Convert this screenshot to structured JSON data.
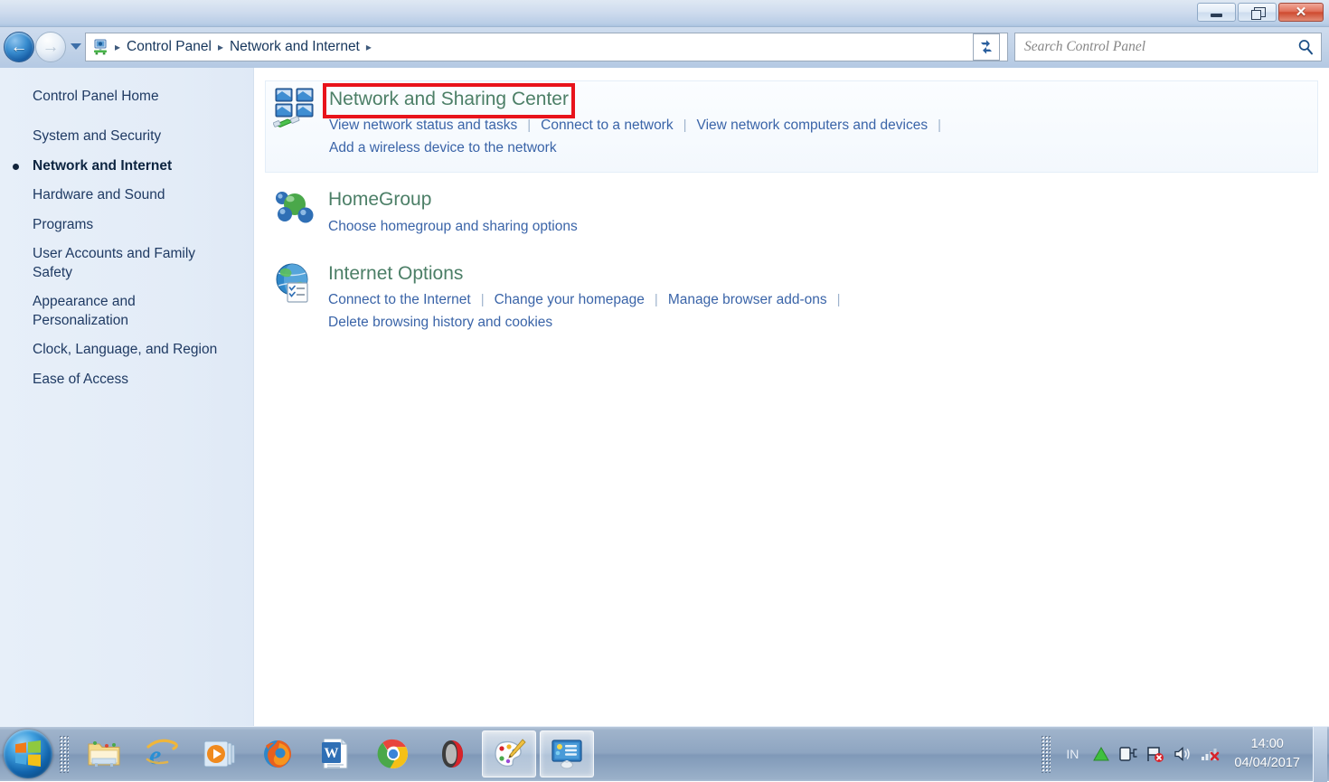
{
  "window": {
    "controls": {
      "minimize_label": "Minimize",
      "maximize_label": "Maximize",
      "close_label": "✕"
    }
  },
  "nav": {
    "back_label": "←",
    "forward_label": "→",
    "recent_pages_label": "Recent pages",
    "breadcrumb_icon": "control-panel-icon",
    "breadcrumbs": [
      {
        "label": "Control Panel"
      },
      {
        "label": "Network and Internet"
      }
    ],
    "separator": "▸",
    "history_dropdown_label": "Previous locations",
    "refresh_label": "Refresh"
  },
  "search": {
    "placeholder": "Search Control Panel",
    "value": "",
    "icon": "search-icon"
  },
  "sidebar": {
    "home": {
      "label": "Control Panel Home"
    },
    "items": [
      {
        "label": "System and Security",
        "active": false
      },
      {
        "label": "Network and Internet",
        "active": true
      },
      {
        "label": "Hardware and Sound",
        "active": false
      },
      {
        "label": "Programs",
        "active": false
      },
      {
        "label": "User Accounts and Family Safety",
        "active": false
      },
      {
        "label": "Appearance and Personalization",
        "active": false
      },
      {
        "label": "Clock, Language, and Region",
        "active": false
      },
      {
        "label": "Ease of Access",
        "active": false
      }
    ]
  },
  "content": {
    "categories": [
      {
        "title": "Network and Sharing Center",
        "icon": "network-sharing-center-icon",
        "highlighted": true,
        "rows": [
          [
            "View network status and tasks",
            "Connect to a network",
            "View network computers and devices"
          ],
          [
            "Add a wireless device to the network"
          ]
        ]
      },
      {
        "title": "HomeGroup",
        "icon": "homegroup-icon",
        "highlighted": false,
        "rows": [
          [
            "Choose homegroup and sharing options"
          ]
        ]
      },
      {
        "title": "Internet Options",
        "icon": "internet-options-icon",
        "highlighted": false,
        "rows": [
          [
            "Connect to the Internet",
            "Change your homepage",
            "Manage browser add-ons"
          ],
          [
            "Delete browsing history and cookies"
          ]
        ]
      }
    ]
  },
  "taskbar": {
    "start_label": "Start",
    "items": [
      {
        "name": "windows-explorer",
        "label": "Windows Explorer",
        "active": false
      },
      {
        "name": "internet-explorer",
        "label": "Internet Explorer",
        "active": false
      },
      {
        "name": "windows-media-player",
        "label": "Windows Media Player",
        "active": false
      },
      {
        "name": "mozilla-firefox",
        "label": "Mozilla Firefox",
        "active": false
      },
      {
        "name": "microsoft-word",
        "label": "Microsoft Word",
        "active": false
      },
      {
        "name": "google-chrome",
        "label": "Google Chrome",
        "active": false
      },
      {
        "name": "opera",
        "label": "Opera",
        "active": false
      },
      {
        "name": "paint",
        "label": "Paint",
        "active": true
      },
      {
        "name": "control-panel",
        "label": "Control Panel",
        "active": true
      }
    ],
    "tray": {
      "language": "IN",
      "icons": [
        {
          "name": "show-hidden-icons",
          "label": "Show hidden icons"
        },
        {
          "name": "battery-icon",
          "label": "Power"
        },
        {
          "name": "action-center-icon",
          "label": "Action Center"
        },
        {
          "name": "volume-icon",
          "label": "Speakers"
        },
        {
          "name": "network-icon",
          "label": "Network"
        }
      ]
    },
    "clock": {
      "time": "14:00",
      "date": "04/04/2017"
    },
    "show_desktop_label": "Show desktop"
  },
  "colors": {
    "accent_blue": "#3a64a8",
    "category_title_green": "#4c7f67",
    "highlight_red": "#e8131b",
    "sidebar_bg": "#e3ecf7",
    "taskbar_bg": "#8ea5c1"
  }
}
